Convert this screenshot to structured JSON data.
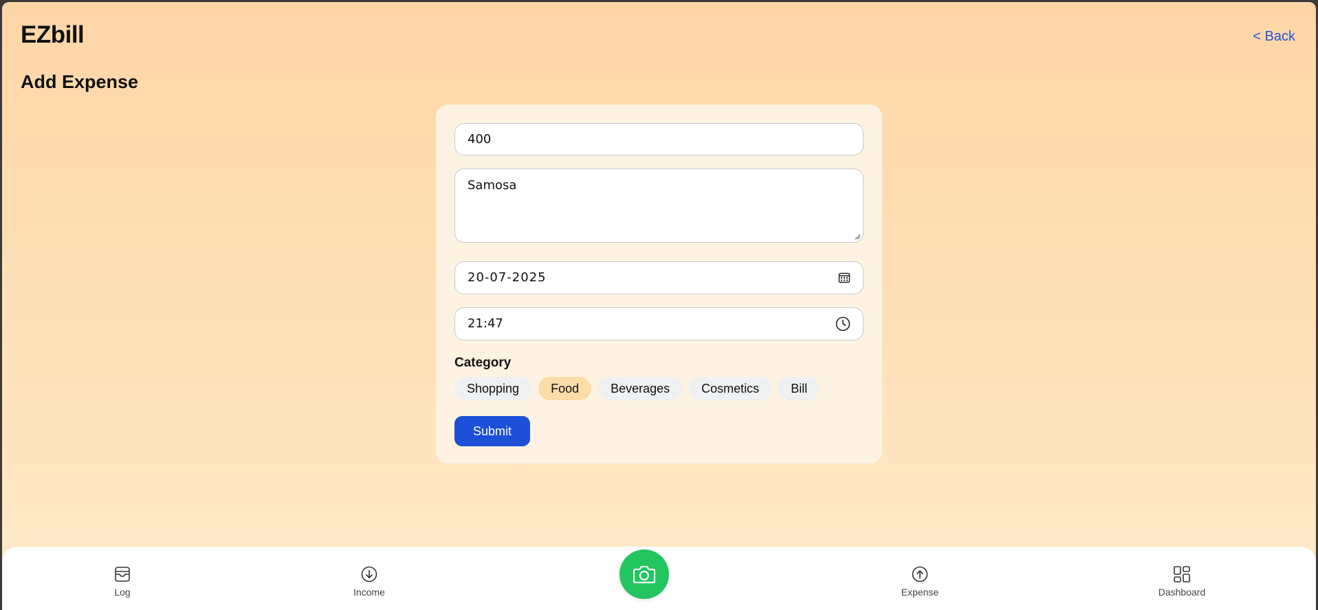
{
  "header": {
    "brand": "EZbill",
    "back_label": "< Back",
    "page_title": "Add Expense"
  },
  "form": {
    "amount": "400",
    "description": "Samosa",
    "date": "20-07-2025",
    "time": "21:47",
    "category_label": "Category",
    "categories": [
      {
        "label": "Shopping",
        "selected": false
      },
      {
        "label": "Food",
        "selected": true
      },
      {
        "label": "Beverages",
        "selected": false
      },
      {
        "label": "Cosmetics",
        "selected": false
      },
      {
        "label": "Bill",
        "selected": false
      }
    ],
    "submit_label": "Submit"
  },
  "bottom_nav": {
    "items": [
      {
        "label": "Log",
        "icon": "inbox-icon"
      },
      {
        "label": "Income",
        "icon": "arrow-down-circle-icon"
      },
      {
        "label": "Expense",
        "icon": "arrow-up-circle-icon"
      },
      {
        "label": "Dashboard",
        "icon": "dashboard-grid-icon"
      }
    ],
    "camera_icon": "camera-icon"
  },
  "colors": {
    "accent": "#1d4fd8",
    "back_link": "#2456d6",
    "camera_button": "#22c55e",
    "selected_chip": "#fcdca8",
    "background_top": "#fed6a6",
    "card": "#fef3e2"
  }
}
